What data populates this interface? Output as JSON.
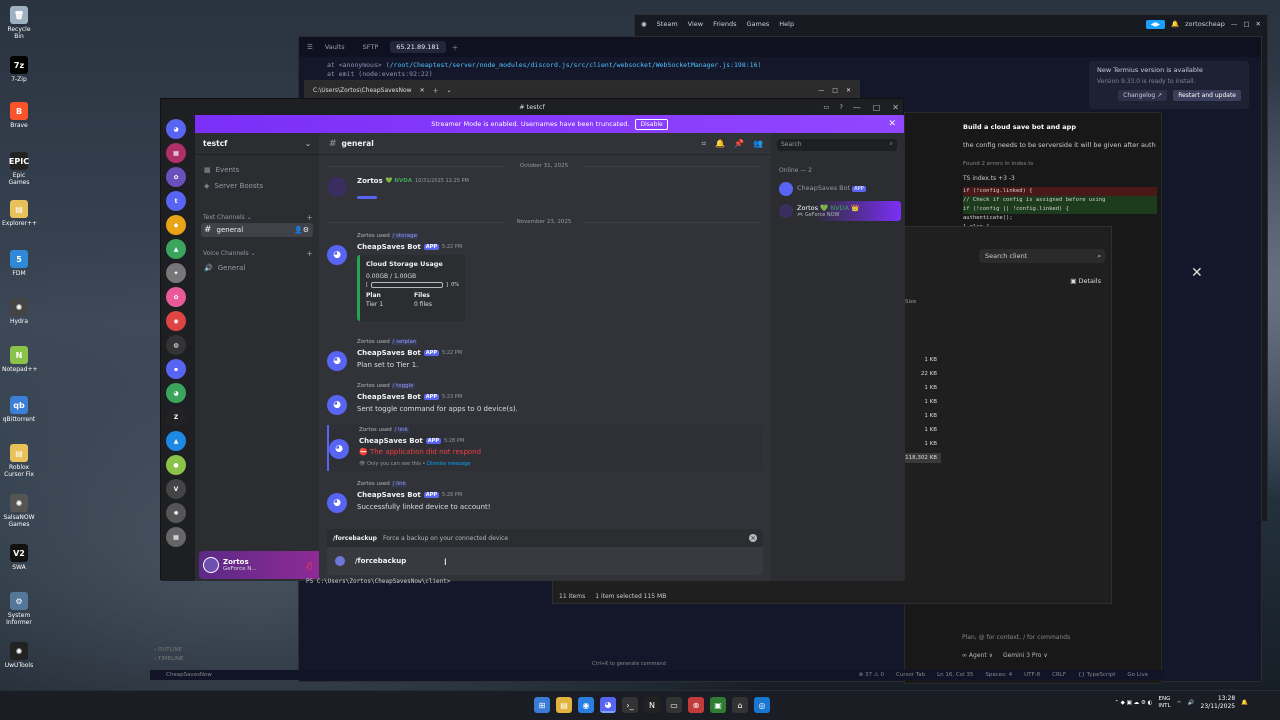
{
  "desktop": {
    "icons": [
      {
        "label": "Recycle Bin",
        "color": "#9fb0c0",
        "glyph": "🗑"
      },
      {
        "label": "7-Zip",
        "color": "#000000",
        "glyph": "7z"
      },
      {
        "label": "Brave",
        "color": "#fb542b",
        "glyph": "B"
      },
      {
        "label": "Epic Games",
        "color": "#222222",
        "glyph": "EPIC"
      },
      {
        "label": "Explorer++",
        "color": "#e8c15a",
        "glyph": "▤"
      },
      {
        "label": "FDM",
        "color": "#2f88d8",
        "glyph": "5"
      },
      {
        "label": "Hydra",
        "color": "#444444",
        "glyph": "✺"
      },
      {
        "label": "Notepad++",
        "color": "#8bc34a",
        "glyph": "N"
      },
      {
        "label": "qBittorrent",
        "color": "#3b7fd6",
        "glyph": "qb"
      },
      {
        "label": "Roblox Cursor Fix",
        "color": "#e8c15a",
        "glyph": "▤"
      },
      {
        "label": "SalsaNOW Games",
        "color": "#555555",
        "glyph": "✺"
      },
      {
        "label": "SWA",
        "color": "#111111",
        "glyph": "V2"
      },
      {
        "label": "System Informer",
        "color": "#557799",
        "glyph": "⚙"
      },
      {
        "label": "UwUTools",
        "color": "#222222",
        "glyph": "✺"
      }
    ]
  },
  "steam": {
    "menu": [
      "Steam",
      "View",
      "Friends",
      "Games",
      "Help"
    ],
    "user": "zortoscheap"
  },
  "termius": {
    "tabs": [
      "Vaults",
      "SFTP",
      "65.21.89.181"
    ],
    "lines": [
      {
        "prefix": "at <anonymous> (",
        "path": "/root/Cheaptest/server/node_modules/discord.js/src/client/websocket/WebSocketManager.js:198:16",
        "suffix": ")"
      },
      {
        "prefix": "at emit (node:events:92:22)",
        "path": "",
        "suffix": ""
      }
    ],
    "notice_title": "New Termius version is available",
    "notice_sub": "Version 9.33.0 is ready to install.",
    "notice_changelog": "Changelog ↗",
    "notice_restart": "Restart and update",
    "side": [
      "OUTLINE",
      "TIMELINE"
    ],
    "status_left": "CheapSavesNow",
    "status_items": [
      "⊗ 37 ⚠ 0",
      "Cursor Tab",
      "Ln 16, Col 35",
      "Spaces: 4",
      "UTF-8",
      "CRLF",
      "{} TypeScript",
      "Go Live"
    ],
    "ctrl_hint": "Ctrl+K to generate command"
  },
  "cmd": {
    "title": "C:\\Users\\Zortos\\CheapSavesNow",
    "prompt": "PS C:\\Users\\Zortos\\CheapSavesNow\\client> "
  },
  "editor": {
    "title": "Build a cloud save bot and app",
    "message": "the config needs to be serverside it will be given after auth",
    "errors": "Found 2 errors in index.ts",
    "file": "TS index.ts +3 -3",
    "code": [
      {
        "t": "if (!config.linked) {",
        "k": "del"
      },
      {
        "t": "  // Check if config is assigned before using",
        "k": "add"
      },
      {
        "t": "if (!config || !config.linked) {",
        "k": "add"
      },
      {
        "t": "  authenticate();",
        "k": ""
      },
      {
        "t": "} else {",
        "k": ""
      }
    ],
    "footer": "Plan, @ for context, / for commands",
    "agent": "∞ Agent ∨",
    "model": "Gemini 3 Pro ∨"
  },
  "explorer": {
    "search_placeholder": "Search client",
    "details": "Details",
    "size_header": "Size",
    "sizes": [
      "1 KB",
      "22 KB",
      "1 KB",
      "1 KB",
      "1 KB",
      "1 KB",
      "1 KB",
      "118,302 KB"
    ],
    "status_items": "11 items",
    "status_selected": "1 item selected  115 MB"
  },
  "discord": {
    "title": "testcf",
    "banner_text": "Streamer Mode is enabled. Usernames have been truncated.",
    "banner_button": "Disable",
    "server_name": "testcf",
    "channels": {
      "events": "Events",
      "boosts": "Server Boosts",
      "text_category": "Text Channels",
      "general": "general",
      "voice_category": "Voice Channels",
      "voice_general": "General"
    },
    "user": {
      "name": "Zortos",
      "status": "GeForce N..."
    },
    "chat": {
      "channel": "general",
      "date1": "October 31, 2025",
      "date2": "November 23, 2025",
      "messages": {
        "m1": {
          "name": "Zortos",
          "badge": "💚 NVDA",
          "time": "10/31/2025 12:25 PM"
        },
        "m2": {
          "user": "Zortos",
          "used": "used",
          "cmd": "/ storage",
          "bot": "CheapSaves Bot",
          "app": "APP",
          "time": "5:22 PM"
        },
        "m3": {
          "user": "Zortos",
          "used": "used",
          "cmd": "/ setplan",
          "bot": "CheapSaves Bot",
          "app": "APP",
          "time": "5:22 PM",
          "body": "Plan set to Tier 1."
        },
        "m4": {
          "user": "Zortos",
          "used": "used",
          "cmd": "/ toggle",
          "bot": "CheapSaves Bot",
          "app": "APP",
          "time": "5:23 PM",
          "body": "Sent toggle command for apps to 0 device(s)."
        },
        "m5": {
          "user": "Zortos",
          "used": "used",
          "cmd": "/ link",
          "bot": "CheapSaves Bot",
          "app": "APP",
          "time": "5:28 PM",
          "body": "The application did not respond",
          "ephemeral": "Only you can see this •",
          "dismiss": "Dismiss message"
        },
        "m6": {
          "user": "Zortos",
          "used": "used",
          "cmd": "/ link",
          "bot": "CheapSaves Bot",
          "app": "APP",
          "time": "5:28 PM",
          "body": "Successfully linked device to account!"
        }
      },
      "embed": {
        "title": "Cloud Storage Usage",
        "usage": "0.00GB / 1.00GB",
        "percent_label": "0%",
        "usage_fraction": 0,
        "plan_h": "Plan",
        "files_h": "Files",
        "plan": "Tier 1",
        "files": "0 files"
      },
      "command_popup": {
        "name": "/forcebackup",
        "desc": "Force a backup on your connected device"
      },
      "composer_value": "/forcebackup"
    },
    "members": {
      "search_placeholder": "Search",
      "online_header": "Online — 2",
      "bot": {
        "name": "CheapSaves Bot",
        "app": "APP"
      },
      "self": {
        "name": "Zortos",
        "badge": "💚 NVDA 👑",
        "sub": "🎮 GeForce NOW"
      }
    }
  },
  "taskbar": {
    "lang1": "ENG",
    "lang2": "INTL",
    "time": "13:28",
    "date": "23/11/2025"
  }
}
